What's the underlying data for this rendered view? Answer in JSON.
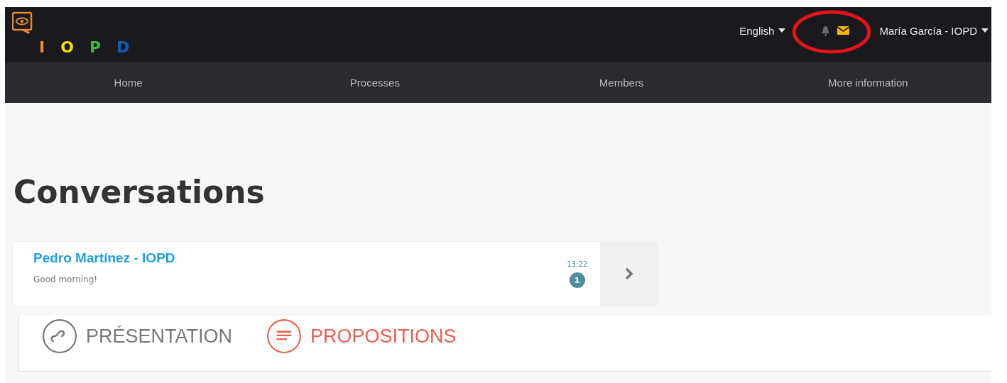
{
  "header": {
    "logo": [
      "I",
      "O",
      "P",
      "D"
    ],
    "language": "English",
    "user": "María García - IOPD"
  },
  "nav": [
    {
      "label": "Home"
    },
    {
      "label": "Processes"
    },
    {
      "label": "Members"
    },
    {
      "label": "More information"
    }
  ],
  "page_title": "Conversations",
  "conversations": [
    {
      "name": "Pedro Martínez - IOPD",
      "message": "Good morning!",
      "time": "13:22",
      "unread": "1"
    }
  ],
  "tabs": [
    {
      "label": "PRÉSENTATION",
      "kind": "presentation",
      "selected": false
    },
    {
      "label": "PROPOSITIONS",
      "kind": "propositions",
      "selected": true
    }
  ]
}
